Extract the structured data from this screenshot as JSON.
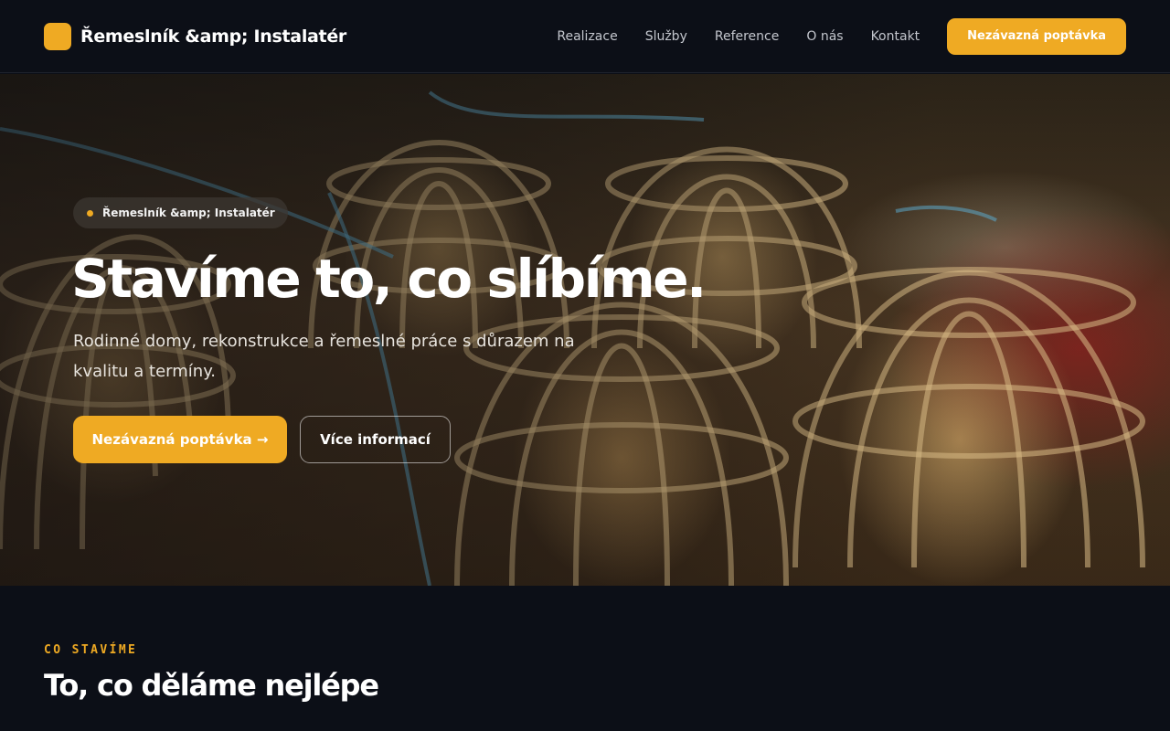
{
  "header": {
    "brand": "Řemeslník &amp; Instalatér",
    "nav": [
      "Realizace",
      "Služby",
      "Reference",
      "O nás",
      "Kontakt"
    ],
    "cta_label": "Nezávazná poptávka"
  },
  "hero": {
    "badge": "Řemeslník &amp; Instalatér",
    "title": "Stavíme to, co slíbíme.",
    "subtitle": "Rodinné domy, rekonstrukce a řemeslné práce s důrazem na kvalitu a termíny.",
    "primary_button": "Nezávazná poptávka →",
    "secondary_button": "Více informací",
    "image_subject": "woven bamboo cages with birds"
  },
  "section": {
    "eyebrow": "CO STAVÍME",
    "title": "To, co děláme nejlépe"
  },
  "colors": {
    "accent": "#efaa23",
    "background": "#0c0f17"
  }
}
